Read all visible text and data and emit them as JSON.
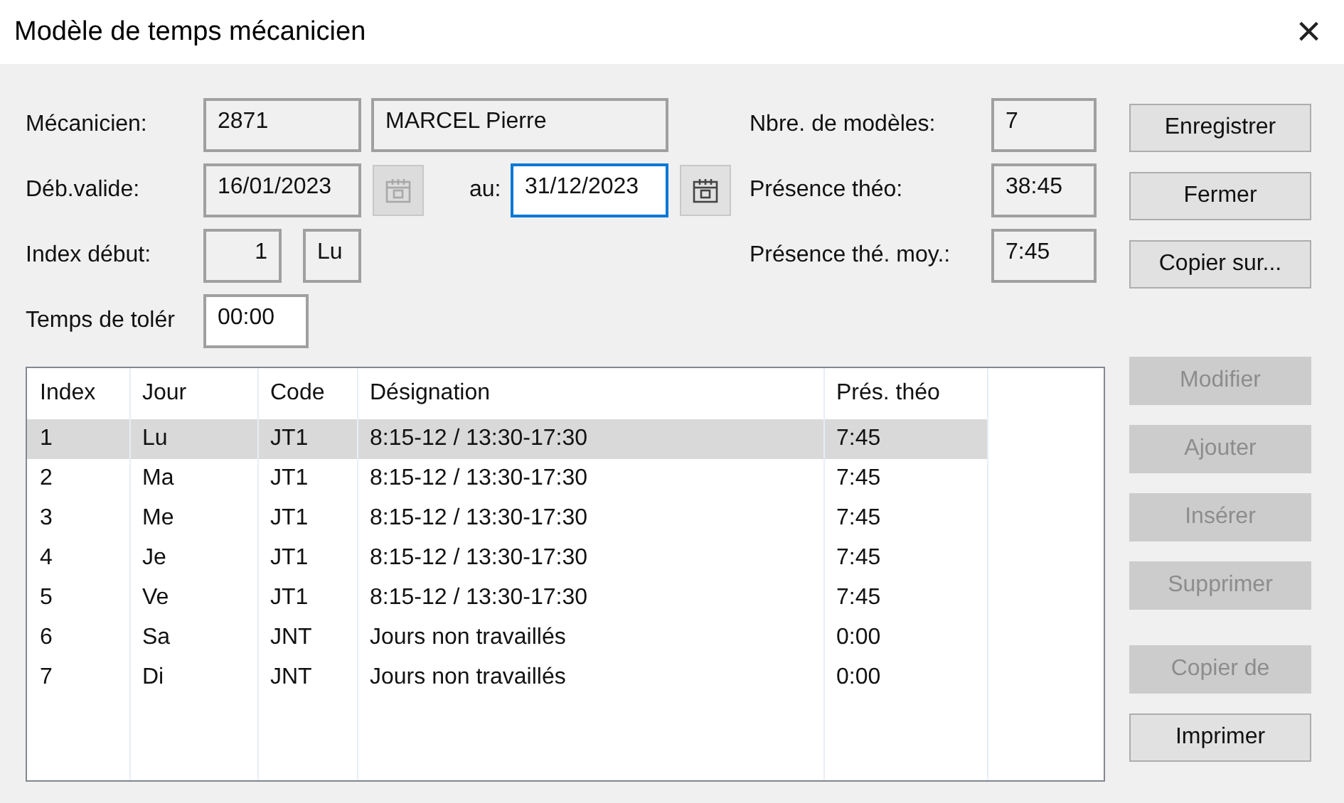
{
  "window": {
    "title": "Modèle de temps mécanicien",
    "close": "×"
  },
  "form": {
    "mecanicien": {
      "label": "Mécanicien:",
      "code": {
        "value": "2871",
        "editable": false,
        "focused": false
      },
      "name": {
        "value": "MARCEL Pierre",
        "editable": false,
        "focused": false
      }
    },
    "validite": {
      "label": "Déb.valide:",
      "start": {
        "value": "16/01/2023",
        "editable": false,
        "focused": false
      },
      "start_calendar": {
        "disabled": true
      },
      "to_label": "au:",
      "end": {
        "value": "31/12/2023",
        "editable": true,
        "focused": true
      },
      "end_calendar": {
        "disabled": false
      }
    },
    "index": {
      "label": "Index début:",
      "number": {
        "value": "1",
        "editable": false,
        "focused": false
      },
      "day": {
        "value": "Lu",
        "editable": false,
        "focused": false
      }
    },
    "tolerance": {
      "label": "Temps de tolér",
      "field": {
        "value": "00:00",
        "editable": true,
        "focused": false
      }
    }
  },
  "summary": [
    {
      "label": "Nbre. de modèles:",
      "value": "7"
    },
    {
      "label": "Présence théo:",
      "value": "38:45"
    },
    {
      "label": "Présence thé. moy.:",
      "value": "7:45"
    }
  ],
  "top_buttons": [
    {
      "label": "Enregistrer",
      "disabled": false
    },
    {
      "label": "Fermer",
      "disabled": false
    },
    {
      "label": "Copier sur...",
      "disabled": false
    }
  ],
  "table": {
    "columns": [
      "Index",
      "Jour",
      "Code",
      "Désignation",
      "Prés. théo"
    ],
    "rows": [
      {
        "cells": [
          "1",
          "Lu",
          "JT1",
          "8:15-12 / 13:30-17:30",
          "7:45"
        ],
        "selected": true
      },
      {
        "cells": [
          "2",
          "Ma",
          "JT1",
          "8:15-12 / 13:30-17:30",
          "7:45"
        ],
        "selected": false
      },
      {
        "cells": [
          "3",
          "Me",
          "JT1",
          "8:15-12 / 13:30-17:30",
          "7:45"
        ],
        "selected": false
      },
      {
        "cells": [
          "4",
          "Je",
          "JT1",
          "8:15-12 / 13:30-17:30",
          "7:45"
        ],
        "selected": false
      },
      {
        "cells": [
          "5",
          "Ve",
          "JT1",
          "8:15-12 / 13:30-17:30",
          "7:45"
        ],
        "selected": false
      },
      {
        "cells": [
          "6",
          "Sa",
          "JNT",
          "Jours non travaillés",
          "0:00"
        ],
        "selected": false
      },
      {
        "cells": [
          "7",
          "Di",
          "JNT",
          "Jours non travaillés",
          "0:00"
        ],
        "selected": false
      }
    ]
  },
  "side_button_groups": [
    [
      {
        "label": "Modifier",
        "disabled": true
      },
      {
        "label": "Ajouter",
        "disabled": true
      },
      {
        "label": "Insérer",
        "disabled": true
      },
      {
        "label": "Supprimer",
        "disabled": true
      }
    ],
    [
      {
        "label": "Copier de",
        "disabled": true
      },
      {
        "label": "Imprimer",
        "disabled": false
      }
    ]
  ]
}
